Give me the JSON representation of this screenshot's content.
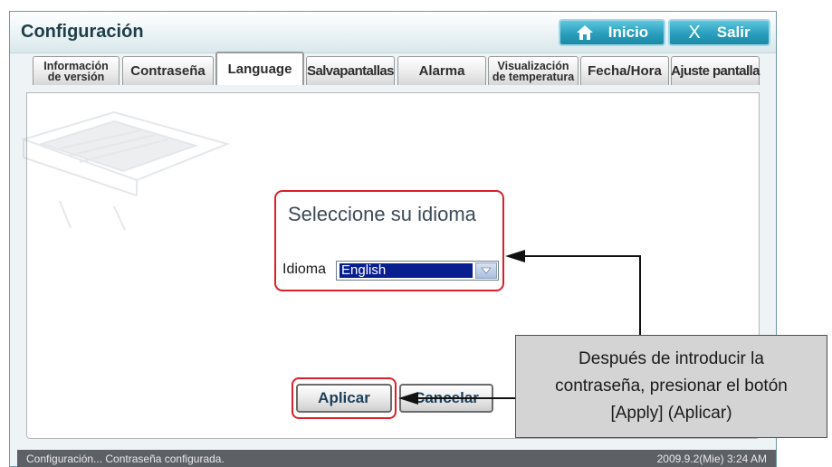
{
  "window": {
    "title": "Configuración",
    "header_buttons": {
      "home_label": "Inicio",
      "home_icon": "home-icon",
      "exit_label": "Salir",
      "exit_glyph": "X"
    }
  },
  "tabs": [
    {
      "label_line1": "Información",
      "label_line2": "de versión",
      "active": false
    },
    {
      "label": "Contraseña",
      "active": false
    },
    {
      "label": "Language",
      "active": true
    },
    {
      "label": "Salvapantallas",
      "active": false
    },
    {
      "label": "Alarma",
      "active": false
    },
    {
      "label_line1": "Visualización",
      "label_line2": "de temperatura",
      "active": false
    },
    {
      "label": "Fecha/Hora",
      "active": false
    },
    {
      "label": "Ajuste pantalla",
      "active": false
    }
  ],
  "language_panel": {
    "title": "Seleccione su idioma",
    "field_label": "Idioma",
    "selected_language": "English"
  },
  "actions": {
    "apply_label": "Aplicar",
    "cancel_label": "Cancelar"
  },
  "callout": {
    "line1": "Después de introducir la",
    "line2": "contraseña, presionar el botón",
    "line3": "[Apply] (Aplicar)"
  },
  "status_bar": {
    "message": "Configuración... Contraseña configurada.",
    "datetime": "2009.9.2(Mie)  3:24 AM"
  },
  "colors": {
    "highlight_border": "#d8212a",
    "header_button": "#2a9ebd",
    "select_highlight": "#0a1f8f",
    "callout_bg": "#d4d4d4"
  }
}
